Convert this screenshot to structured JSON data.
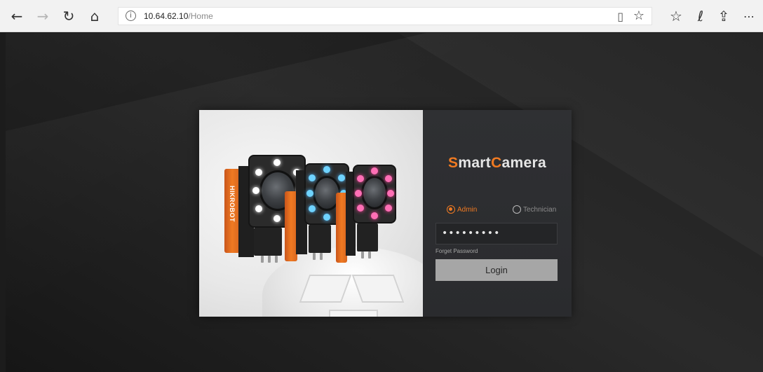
{
  "browser": {
    "url_host": "10.64.62.10",
    "url_path": "/Home",
    "icons": [
      "back-icon",
      "forward-icon",
      "refresh-icon",
      "home-icon",
      "info-icon",
      "reading-view-icon",
      "favorite-star-icon",
      "favorites-list-icon",
      "pen-icon",
      "share-icon",
      "more-icon"
    ]
  },
  "login": {
    "brand_s": "S",
    "brand_mart": "mart",
    "brand_c": "C",
    "brand_amera": "amera",
    "accent_color": "#f07a22",
    "roles": [
      {
        "label": "Admin",
        "selected": true
      },
      {
        "label": "Technician",
        "selected": false
      }
    ],
    "password_value": "•••••••••",
    "forget_password": "Forget Password",
    "login_button": "Login"
  },
  "hero": {
    "logo_text": "HIKROBOT",
    "cameras": [
      "white-light-camera",
      "blue-light-camera",
      "pink-light-camera"
    ]
  }
}
